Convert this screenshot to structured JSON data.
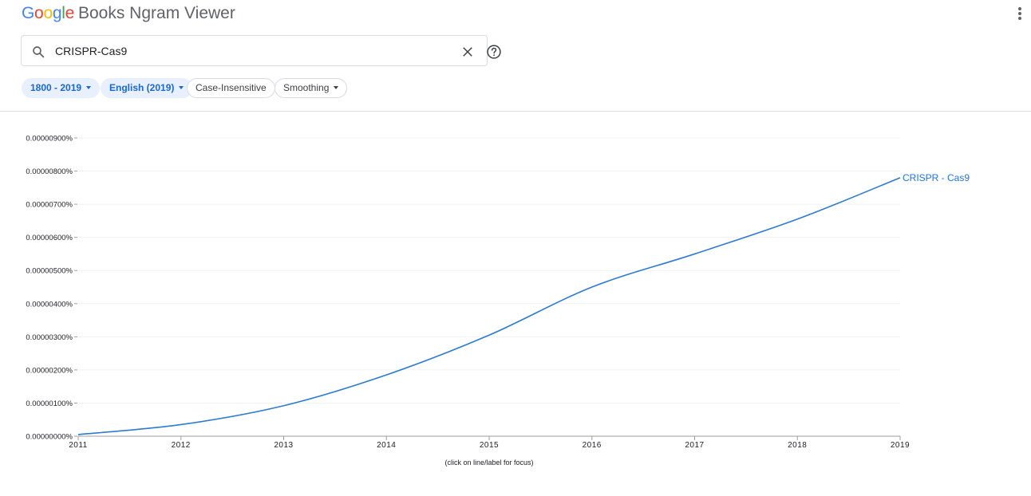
{
  "header": {
    "logo_letters": [
      {
        "ch": "G",
        "color": "#4285F4"
      },
      {
        "ch": "o",
        "color": "#EA4335"
      },
      {
        "ch": "o",
        "color": "#FBBC05"
      },
      {
        "ch": "g",
        "color": "#4285F4"
      },
      {
        "ch": "l",
        "color": "#34A853"
      },
      {
        "ch": "e",
        "color": "#EA4335"
      }
    ],
    "logo_word": "Google",
    "app_title": "Books Ngram Viewer",
    "menu_icon": "more-vert-icon"
  },
  "search": {
    "value": "CRISPR-Cas9",
    "search_icon": "search-icon",
    "clear_icon": "close-icon",
    "help_icon": "help-icon"
  },
  "filters": {
    "year_range": "1800 - 2019",
    "corpus": "English (2019)",
    "case": "Case-Insensitive",
    "smoothing": "Smoothing"
  },
  "colors": {
    "accent": "#1a73e8",
    "line": "#2b7bd0",
    "chip_bg": "#e8f0fe"
  },
  "chart_data": {
    "type": "line",
    "x": [
      2011,
      2012,
      2013,
      2014,
      2015,
      2016,
      2017,
      2018,
      2019
    ],
    "series": [
      {
        "name": "CRISPR - Cas9",
        "values": [
          5e-08,
          3.5e-07,
          9.2e-07,
          1.85e-06,
          3.05e-06,
          4.5e-06,
          5.5e-06,
          6.55e-06,
          7.8e-06
        ]
      }
    ],
    "yticks": [
      "0.00000000%",
      "0.00000100%",
      "0.00000200%",
      "0.00000300%",
      "0.00000400%",
      "0.00000500%",
      "0.00000600%",
      "0.00000700%",
      "0.00000800%",
      "0.00000900%"
    ],
    "ylim": [
      0,
      9e-06
    ],
    "xlim": [
      2011,
      2019
    ],
    "grid": true,
    "footnote": "(click on line/label for focus)"
  }
}
